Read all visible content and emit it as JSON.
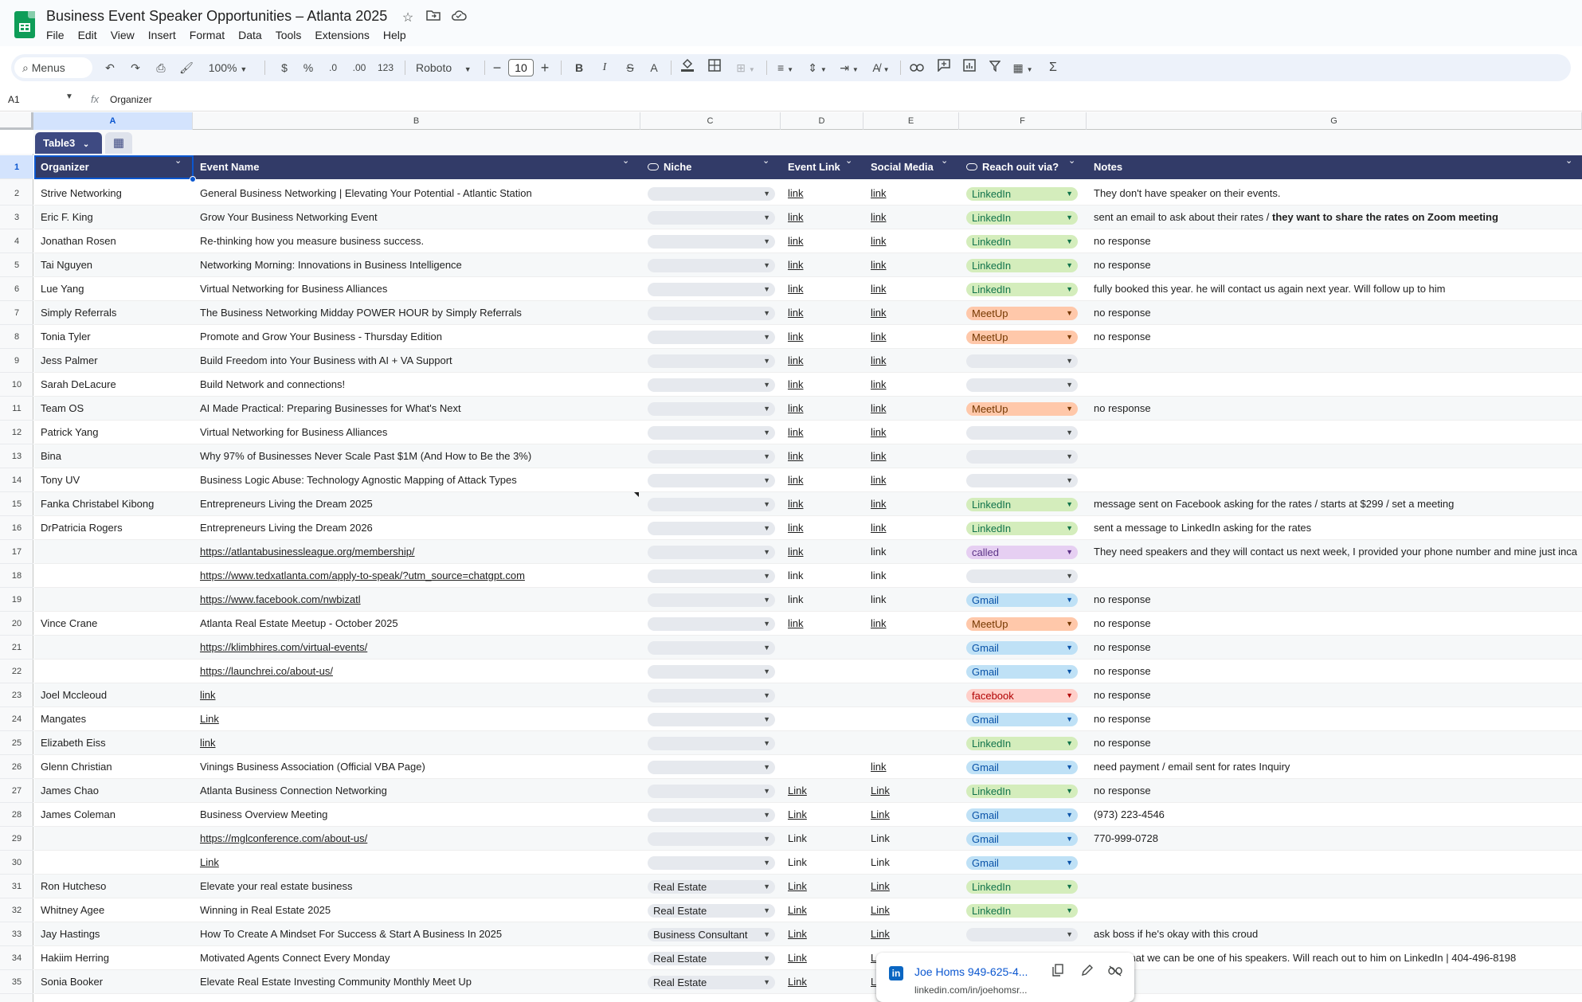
{
  "app": {
    "title": "Business Event Speaker Opportunities – Atlanta 2025",
    "menu": [
      "File",
      "Edit",
      "View",
      "Insert",
      "Format",
      "Data",
      "Tools",
      "Extensions",
      "Help"
    ]
  },
  "toolbar": {
    "search_label": "Menus",
    "zoom": "100%",
    "currency": "$",
    "percent": "%",
    "decrease_decimal": ".0",
    "increase_decimal": ".00",
    "number_format": "123",
    "font": "Roboto",
    "font_size": "10",
    "bold": "B",
    "italic": "I",
    "sum": "Σ"
  },
  "formula_bar": {
    "cell_ref": "A1",
    "fx": "fx",
    "content": "Organizer"
  },
  "columns": [
    "A",
    "B",
    "C",
    "D",
    "E",
    "F",
    "G"
  ],
  "table_name": "Table3",
  "headers": {
    "organizer": "Organizer",
    "event_name": "Event Name",
    "niche": "Niche",
    "event_link": "Event Link",
    "social_media": "Social Media",
    "reach_out": "Reach ouit via?",
    "notes": "Notes"
  },
  "rows": [
    {
      "n": "2",
      "org": "Strive Networking",
      "event": "General Business Networking | Elevating Your Potential - Atlantic Station",
      "event_link": false,
      "niche": "",
      "elink": "link",
      "elink_u": true,
      "social": "link",
      "social_u": true,
      "reach": "LinkedIn",
      "reach_type": "linkedin",
      "notes": "They don't have speaker on their events.",
      "notes_bold": ""
    },
    {
      "n": "3",
      "org": "Eric F. King",
      "event": "Grow Your Business Networking Event",
      "event_link": false,
      "niche": "",
      "elink": "link",
      "elink_u": true,
      "social": "link",
      "social_u": true,
      "reach": "LinkedIn",
      "reach_type": "linkedin",
      "notes": "sent an email to ask about their rates / ",
      "notes_bold": "they want to share the rates on Zoom meeting"
    },
    {
      "n": "4",
      "org": "Jonathan Rosen",
      "event": "Re-thinking how you measure business success.",
      "event_link": false,
      "niche": "",
      "elink": "link",
      "elink_u": true,
      "social": "link",
      "social_u": true,
      "reach": "LinkedIn",
      "reach_type": "linkedin",
      "notes": "no response",
      "notes_bold": ""
    },
    {
      "n": "5",
      "org": "Tai Nguyen",
      "event": "Networking Morning: Innovations in Business Intelligence",
      "event_link": false,
      "niche": "",
      "elink": "link",
      "elink_u": true,
      "social": "link",
      "social_u": true,
      "reach": "LinkedIn",
      "reach_type": "linkedin",
      "notes": "no response",
      "notes_bold": ""
    },
    {
      "n": "6",
      "org": "Lue Yang",
      "event": "Virtual Networking for Business Alliances",
      "event_link": false,
      "niche": "",
      "elink": "link",
      "elink_u": true,
      "social": "link",
      "social_u": true,
      "reach": "LinkedIn",
      "reach_type": "linkedin",
      "notes": "fully booked this year. he will contact us again next year. Will follow up to him",
      "notes_bold": ""
    },
    {
      "n": "7",
      "org": "Simply Referrals",
      "event": "The Business Networking Midday POWER HOUR by Simply Referrals",
      "event_link": false,
      "niche": "",
      "elink": "link",
      "elink_u": true,
      "social": "link",
      "social_u": true,
      "reach": "MeetUp",
      "reach_type": "meetup",
      "notes": "no response",
      "notes_bold": ""
    },
    {
      "n": "8",
      "org": "Tonia Tyler",
      "event": "Promote and Grow Your Business - Thursday Edition",
      "event_link": false,
      "niche": "",
      "elink": "link",
      "elink_u": true,
      "social": "link",
      "social_u": true,
      "reach": "MeetUp",
      "reach_type": "meetup",
      "notes": "no response",
      "notes_bold": ""
    },
    {
      "n": "9",
      "org": "Jess Palmer",
      "event": "Build Freedom into Your Business with AI + VA Support",
      "event_link": false,
      "niche": "",
      "elink": "link",
      "elink_u": true,
      "social": "link",
      "social_u": true,
      "reach": "",
      "reach_type": "empty",
      "notes": "",
      "notes_bold": ""
    },
    {
      "n": "10",
      "org": "Sarah DeLacure",
      "event": "Build Network and connections!",
      "event_link": false,
      "niche": "",
      "elink": "link",
      "elink_u": true,
      "social": "link",
      "social_u": true,
      "reach": "",
      "reach_type": "empty",
      "notes": "",
      "notes_bold": ""
    },
    {
      "n": "11",
      "org": "Team OS",
      "event": "AI Made Practical: Preparing Businesses for What's Next",
      "event_link": false,
      "niche": "",
      "elink": "link",
      "elink_u": true,
      "social": "link",
      "social_u": true,
      "reach": "MeetUp",
      "reach_type": "meetup",
      "notes": "no response",
      "notes_bold": ""
    },
    {
      "n": "12",
      "org": "Patrick Yang",
      "event": "Virtual Networking for Business Alliances",
      "event_link": false,
      "niche": "",
      "elink": "link",
      "elink_u": true,
      "social": "link",
      "social_u": true,
      "reach": "",
      "reach_type": "empty",
      "notes": "",
      "notes_bold": ""
    },
    {
      "n": "13",
      "org": "Bina",
      "event": "Why 97% of Businesses Never Scale Past $1M (And How to Be the 3%)",
      "event_link": false,
      "niche": "",
      "elink": "link",
      "elink_u": true,
      "social": "link",
      "social_u": true,
      "reach": "",
      "reach_type": "empty",
      "notes": "",
      "notes_bold": ""
    },
    {
      "n": "14",
      "org": "Tony UV",
      "event": "Business Logic Abuse: Technology Agnostic Mapping of Attack Types",
      "event_link": false,
      "niche": "",
      "elink": "link",
      "elink_u": true,
      "social": "link",
      "social_u": true,
      "reach": "",
      "reach_type": "empty",
      "notes": "",
      "notes_bold": ""
    },
    {
      "n": "15",
      "org": "Fanka Christabel Kibong",
      "event": " Entrepreneurs Living the Dream 2025",
      "event_link": false,
      "niche": "",
      "elink": "link",
      "elink_u": true,
      "social": "link",
      "social_u": true,
      "reach": "LinkedIn",
      "reach_type": "linkedin",
      "notes": "message sent on Facebook asking for the rates / starts at $299 / set a meeting",
      "notes_bold": ""
    },
    {
      "n": "16",
      "org": "DrPatricia Rogers",
      "event": " Entrepreneurs Living the Dream 2026",
      "event_link": false,
      "niche": "",
      "elink": "link",
      "elink_u": true,
      "social": "link",
      "social_u": true,
      "reach": "LinkedIn",
      "reach_type": "linkedin",
      "notes": "sent a message to LinkedIn asking for the rates",
      "notes_bold": ""
    },
    {
      "n": "17",
      "org": "",
      "event": "https://atlantabusinessleague.org/membership/",
      "event_link": true,
      "niche": "",
      "elink": "link",
      "elink_u": true,
      "social": "link",
      "social_u": false,
      "reach": "called",
      "reach_type": "called",
      "notes": "They need speakers and they will contact us next week, I provided your phone number and mine just inca",
      "notes_bold": ""
    },
    {
      "n": "18",
      "org": "",
      "event": "https://www.tedxatlanta.com/apply-to-speak/?utm_source=chatgpt.com",
      "event_link": true,
      "niche": "",
      "elink": "link",
      "elink_u": false,
      "social": "link",
      "social_u": false,
      "reach": "",
      "reach_type": "empty",
      "notes": "",
      "notes_bold": ""
    },
    {
      "n": "19",
      "org": "",
      "event": "https://www.facebook.com/nwbizatl",
      "event_link": true,
      "niche": "",
      "elink": "link",
      "elink_u": false,
      "social": "link",
      "social_u": false,
      "reach": "Gmail",
      "reach_type": "gmail",
      "notes": "no response",
      "notes_bold": ""
    },
    {
      "n": "20",
      "org": "Vince Crane",
      "event": "Atlanta Real Estate Meetup - October 2025",
      "event_link": false,
      "niche": "",
      "elink": "link",
      "elink_u": true,
      "social": "link",
      "social_u": true,
      "reach": "MeetUp",
      "reach_type": "meetup",
      "notes": "no response",
      "notes_bold": ""
    },
    {
      "n": "21",
      "org": "",
      "event": "https://klimbhires.com/virtual-events/",
      "event_link": true,
      "niche": "",
      "elink": "",
      "elink_u": false,
      "social": "",
      "social_u": false,
      "reach": "Gmail",
      "reach_type": "gmail",
      "notes": "no response",
      "notes_bold": ""
    },
    {
      "n": "22",
      "org": "",
      "event": "https://launchrei.co/about-us/",
      "event_link": true,
      "niche": "",
      "elink": "",
      "elink_u": false,
      "social": "",
      "social_u": false,
      "reach": "Gmail",
      "reach_type": "gmail",
      "notes": "no response",
      "notes_bold": ""
    },
    {
      "n": "23",
      "org": "Joel Mccleoud",
      "event": "link",
      "event_link": true,
      "niche": "",
      "elink": "",
      "elink_u": false,
      "social": "",
      "social_u": false,
      "reach": "facebook",
      "reach_type": "facebook",
      "notes": "no response",
      "notes_bold": ""
    },
    {
      "n": "24",
      "org": "Mangates",
      "event": "Link",
      "event_link": true,
      "niche": "",
      "elink": "",
      "elink_u": false,
      "social": "",
      "social_u": false,
      "reach": "Gmail",
      "reach_type": "gmail",
      "notes": "no response",
      "notes_bold": ""
    },
    {
      "n": "25",
      "org": "Elizabeth Eiss",
      "event": "link",
      "event_link": true,
      "niche": "",
      "elink": "",
      "elink_u": false,
      "social": "",
      "social_u": false,
      "reach": "LinkedIn",
      "reach_type": "linkedin",
      "notes": "no response",
      "notes_bold": ""
    },
    {
      "n": "26",
      "org": "Glenn Christian",
      "event": "Vinings Business Association (Official VBA Page)",
      "event_link": false,
      "niche": "",
      "elink": "",
      "elink_u": false,
      "social": "link",
      "social_u": true,
      "reach": "Gmail",
      "reach_type": "gmail",
      "notes": "need payment / email sent for rates Inquiry",
      "notes_bold": ""
    },
    {
      "n": "27",
      "org": "James Chao",
      "event": "Atlanta Business Connection Networking",
      "event_link": false,
      "niche": "",
      "elink": "Link",
      "elink_u": true,
      "social": "Link",
      "social_u": true,
      "reach": "LinkedIn",
      "reach_type": "linkedin",
      "notes": "no response",
      "notes_bold": ""
    },
    {
      "n": "28",
      "org": "James Coleman",
      "event": "Business Overview Meeting",
      "event_link": false,
      "niche": "",
      "elink": "Link",
      "elink_u": true,
      "social": "Link",
      "social_u": true,
      "reach": "Gmail",
      "reach_type": "gmail",
      "notes": "(973) 223-4546",
      "notes_bold": ""
    },
    {
      "n": "29",
      "org": "",
      "event": "https://mglconference.com/about-us/",
      "event_link": true,
      "niche": "",
      "elink": "Link",
      "elink_u": false,
      "social": "Link",
      "social_u": false,
      "reach": "Gmail",
      "reach_type": "gmail",
      "notes": "770-999-0728",
      "notes_bold": ""
    },
    {
      "n": "30",
      "org": "",
      "event": "Link",
      "event_link": true,
      "niche": "",
      "elink": "Link",
      "elink_u": false,
      "social": "Link",
      "social_u": false,
      "reach": "Gmail",
      "reach_type": "gmail",
      "notes": "",
      "notes_bold": ""
    },
    {
      "n": "31",
      "org": "Ron Hutcheso",
      "event": "Elevate your real estate business",
      "event_link": false,
      "niche": "Real Estate",
      "elink": "Link",
      "elink_u": true,
      "social": "Link",
      "social_u": true,
      "reach": "LinkedIn",
      "reach_type": "linkedin",
      "notes": "",
      "notes_bold": ""
    },
    {
      "n": "32",
      "org": "Whitney Agee",
      "event": "Winning in Real Estate 2025",
      "event_link": false,
      "niche": "Real Estate",
      "elink": "Link",
      "elink_u": true,
      "social": "Link",
      "social_u": true,
      "reach": "LinkedIn",
      "reach_type": "linkedin",
      "notes": "",
      "notes_bold": ""
    },
    {
      "n": "33",
      "org": "Jay Hastings",
      "event": "How To Create A Mindset For Success & Start A Business In 2025",
      "event_link": false,
      "niche": "Business Consultant",
      "elink": "Link",
      "elink_u": true,
      "social": "Link",
      "social_u": true,
      "reach": "",
      "reach_type": "empty",
      "notes": "ask boss if he's okay with this croud",
      "notes_bold": ""
    },
    {
      "n": "34",
      "org": "Hakiim Herring",
      "event": "Motivated Agents Connect Every Monday",
      "event_link": false,
      "niche": "Real Estate",
      "elink": "Link",
      "elink_u": true,
      "social": "L",
      "social_u": true,
      "reach": "",
      "reach_type": "hidden",
      "notes": "m said that we can be one of his speakers. Will reach out to him on LinkedIn | 404-496-8198",
      "notes_bold": ""
    },
    {
      "n": "35",
      "org": "Sonia Booker",
      "event": "Elevate Real Estate Investing Community Monthly Meet Up",
      "event_link": false,
      "niche": "Real Estate",
      "elink": "Link",
      "elink_u": true,
      "social": "L",
      "social_u": true,
      "reach": "",
      "reach_type": "hidden",
      "notes": "",
      "notes_bold": ""
    }
  ],
  "link_popup": {
    "title": "Joe Homs 949-625-4...",
    "url": "linkedin.com/in/joehomsr..."
  },
  "colors": {
    "header_bg": "#323b68",
    "linkedin": "#d4edbc",
    "meetup": "#ffc8aa",
    "gmail": "#bfe1f6",
    "facebook": "#ffcfc9",
    "called": "#e6cff2",
    "accent": "#0b57d0"
  }
}
